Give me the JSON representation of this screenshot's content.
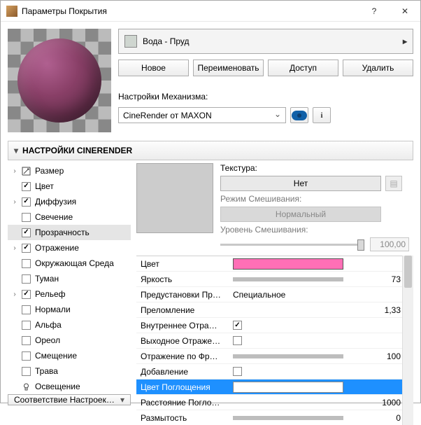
{
  "window": {
    "title": "Параметры Покрытия"
  },
  "material": {
    "name": "Вода - Пруд"
  },
  "buttons": {
    "new": "Новое",
    "rename": "Переименовать",
    "access": "Доступ",
    "delete": "Удалить"
  },
  "engine": {
    "label": "Настройки Механизма:",
    "value": "CineRender от MAXON"
  },
  "section": {
    "title": "НАСТРОЙКИ CINERENDER"
  },
  "tree": {
    "items": [
      {
        "label": "Размер",
        "checked": null,
        "expander": "›",
        "icon": "size"
      },
      {
        "label": "Цвет",
        "checked": true,
        "expander": ""
      },
      {
        "label": "Диффузия",
        "checked": true,
        "expander": "›"
      },
      {
        "label": "Свечение",
        "checked": false,
        "expander": ""
      },
      {
        "label": "Прозрачность",
        "checked": true,
        "expander": "",
        "selected": true
      },
      {
        "label": "Отражение",
        "checked": true,
        "expander": "›"
      },
      {
        "label": "Окружающая Среда",
        "checked": false,
        "expander": ""
      },
      {
        "label": "Туман",
        "checked": false,
        "expander": ""
      },
      {
        "label": "Рельеф",
        "checked": true,
        "expander": "›"
      },
      {
        "label": "Нормали",
        "checked": false,
        "expander": ""
      },
      {
        "label": "Альфа",
        "checked": false,
        "expander": ""
      },
      {
        "label": "Ореол",
        "checked": false,
        "expander": ""
      },
      {
        "label": "Смещение",
        "checked": false,
        "expander": ""
      },
      {
        "label": "Трава",
        "checked": false,
        "expander": ""
      },
      {
        "label": "Освещение",
        "checked": null,
        "expander": "",
        "icon": "light"
      }
    ]
  },
  "match_button": "Соответствие Настроек…",
  "texture": {
    "label": "Текстура:",
    "none": "Нет",
    "blend_label": "Режим Смешивания:",
    "blend_value": "Нормальный",
    "level_label": "Уровень Смешивания:",
    "level_value": "100,00"
  },
  "props": [
    {
      "label": "Цвет",
      "type": "color",
      "color": "pink"
    },
    {
      "label": "Яркость",
      "type": "bar",
      "value": "73"
    },
    {
      "label": "Предустановки Пр…",
      "type": "text",
      "value": "Специальное"
    },
    {
      "label": "Преломление",
      "type": "num",
      "value": "1,33"
    },
    {
      "label": "Внутреннее Отра…",
      "type": "check",
      "checked": true
    },
    {
      "label": "Выходное Отраже…",
      "type": "check",
      "checked": false
    },
    {
      "label": "Отражение по Фр…",
      "type": "bar",
      "value": "100"
    },
    {
      "label": "Добавление",
      "type": "check",
      "checked": false
    },
    {
      "label": "Цвет Поглощения",
      "type": "color",
      "color": "white",
      "selected": true
    },
    {
      "label": "Расстояние Погло…",
      "type": "num",
      "value": "1000"
    },
    {
      "label": "Размытость",
      "type": "bar-min",
      "value": "0"
    }
  ]
}
